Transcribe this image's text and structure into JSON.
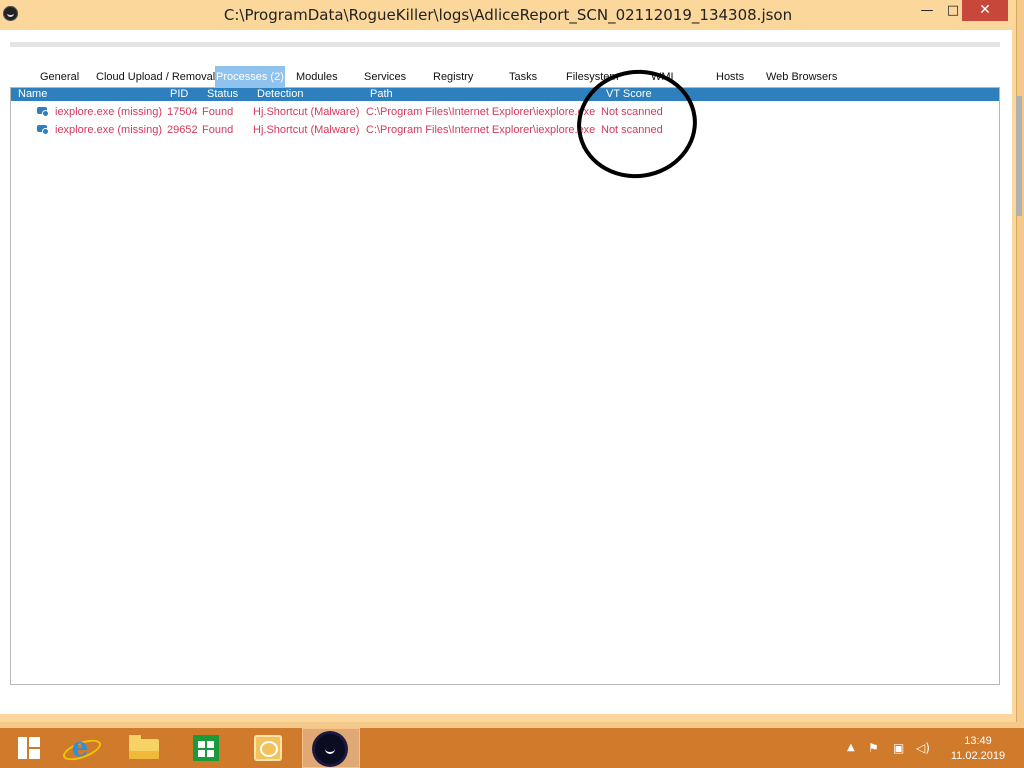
{
  "window": {
    "title": "C:\\ProgramData\\RogueKiller\\logs\\AdliceReport_SCN_02112019_134308.json",
    "min_label": "—",
    "max_label": "□",
    "close_label": "✕"
  },
  "tabs": [
    {
      "label": "General"
    },
    {
      "label": "Cloud Upload / Removal"
    },
    {
      "label": "Processes (2)",
      "active": true
    },
    {
      "label": "Modules"
    },
    {
      "label": "Services"
    },
    {
      "label": "Registry"
    },
    {
      "label": "Tasks"
    },
    {
      "label": "Filesystem"
    },
    {
      "label": "WMI"
    },
    {
      "label": "Hosts"
    },
    {
      "label": "Web Browsers"
    }
  ],
  "table": {
    "columns": [
      "Name",
      "PID",
      "Status",
      "Detection",
      "Path",
      "VT Score"
    ],
    "rows": [
      {
        "name": "iexplore.exe (missing)",
        "pid": "17504",
        "status": "Found",
        "detection": "Hj.Shortcut (Malware)",
        "path": "C:\\Program Files\\Internet Explorer\\iexplore.exe",
        "vt": "Not scanned"
      },
      {
        "name": "iexplore.exe (missing)",
        "pid": "29652",
        "status": "Found",
        "detection": "Hj.Shortcut (Malware)",
        "path": "C:\\Program Files\\Internet Explorer\\iexplore.exe",
        "vt": "Not scanned"
      }
    ]
  },
  "taskbar": {
    "apps": [
      "start-icon",
      "internet-explorer-icon",
      "file-explorer-icon",
      "store-icon",
      "mail-icon",
      "roguekiller-icon"
    ],
    "tray_up": "▲",
    "tray_flag": "⚑",
    "tray_net": "▣",
    "tray_volume": "◁)",
    "time": "13:49",
    "date": "11.02.2019"
  },
  "colors": {
    "accent": "#2d80bd",
    "detection_text": "#d33a5c",
    "window_frame": "#fbd79c",
    "taskbar": "#d07a2b"
  }
}
